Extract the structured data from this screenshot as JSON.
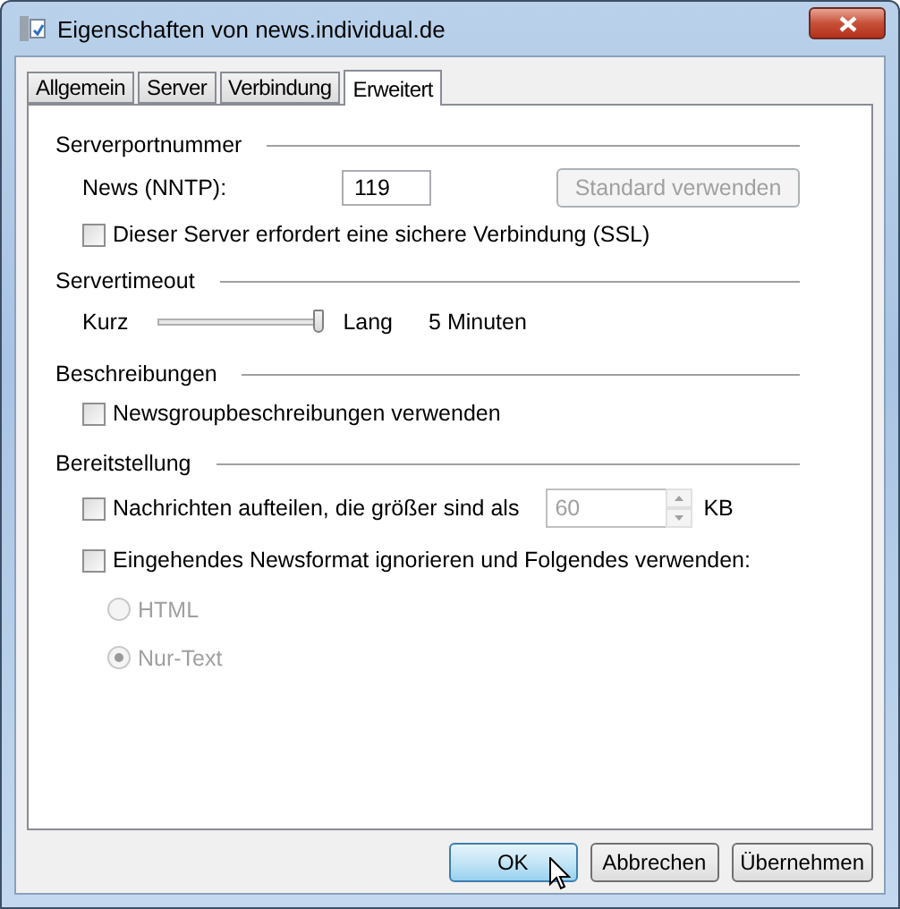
{
  "window": {
    "title": "Eigenschaften von news.individual.de"
  },
  "tabs": [
    {
      "label": "Allgemein",
      "selected": false
    },
    {
      "label": "Server",
      "selected": false
    },
    {
      "label": "Verbindung",
      "selected": false
    },
    {
      "label": "Erweitert",
      "selected": true
    }
  ],
  "port_group": {
    "title": "Serverportnummer",
    "label": "News (NNTP):",
    "value": "119",
    "default_button": {
      "label": "Standard verwenden",
      "disabled": true
    },
    "ssl": {
      "label": "Dieser Server erfordert eine sichere Verbindung (SSL)",
      "checked": false
    }
  },
  "timeout_group": {
    "title": "Servertimeout",
    "min_label": "Kurz",
    "max_label": "Lang",
    "level": 1.0,
    "reading": "5 Minuten"
  },
  "descriptions_group": {
    "title": "Beschreibungen",
    "option": {
      "label": "Newsgroupbeschreibungen verwenden",
      "checked": false
    }
  },
  "delivery_group": {
    "title": "Bereitstellung",
    "split": {
      "label": "Nachrichten aufteilen, die größer sind als",
      "checked": false,
      "value": "60",
      "unit": "KB",
      "disabled": true
    },
    "override": {
      "label": "Eingehendes Newsformat ignorieren und Folgendes verwenden:",
      "checked": false
    },
    "formats": [
      {
        "label": "HTML",
        "selected": false,
        "disabled": true
      },
      {
        "label": "Nur-Text",
        "selected": true,
        "disabled": true
      }
    ]
  },
  "buttons": [
    {
      "label": "OK",
      "default": true
    },
    {
      "label": "Abbrechen",
      "default": false
    },
    {
      "label": "Übernehmen",
      "default": false
    }
  ]
}
